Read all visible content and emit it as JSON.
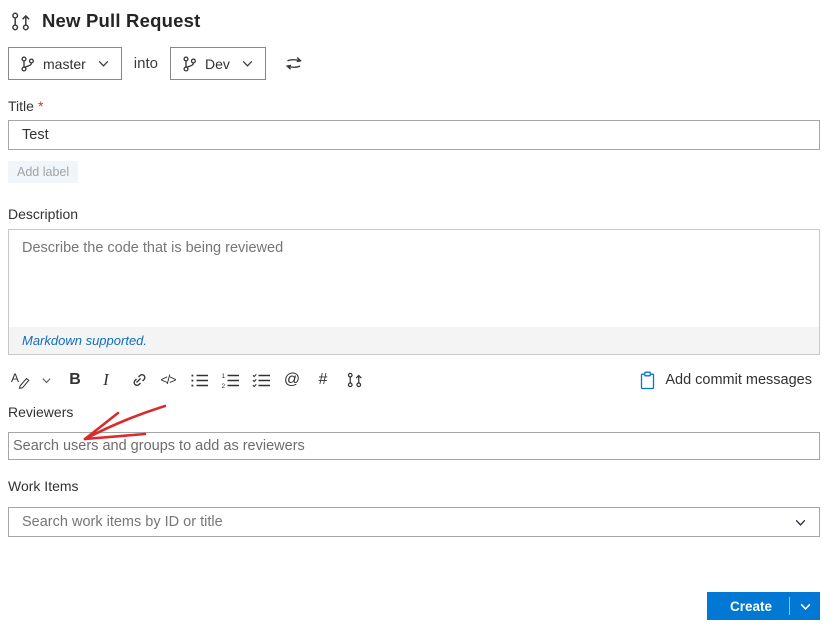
{
  "page": {
    "title": "New Pull Request"
  },
  "branch_selector": {
    "source_branch": "master",
    "into_label": "into",
    "target_branch": "Dev"
  },
  "title_field": {
    "label": "Title",
    "required_marker": "*",
    "value": "Test"
  },
  "labels_section": {
    "add_label": "Add label"
  },
  "description_field": {
    "label": "Description",
    "placeholder": "Describe the code that is being reviewed",
    "markdown_note": "Markdown supported."
  },
  "toolbar": {
    "bold": "B",
    "italic": "I",
    "code": "</>",
    "mention": "@",
    "work_item_ref": "#",
    "add_commit_messages": "Add commit messages"
  },
  "reviewers_field": {
    "label": "Reviewers",
    "placeholder": "Search users and groups to add as reviewers"
  },
  "work_items_field": {
    "label": "Work Items",
    "placeholder": "Search work items by ID or title"
  },
  "actions": {
    "create": "Create"
  },
  "colors": {
    "primary_blue": "#0078d4",
    "link_blue": "#106ebe",
    "required_red": "#d13438",
    "annotation_red": "#d92b2b",
    "input_border": "#a6a6a6",
    "markdown_bar_bg": "#f4f4f4"
  },
  "icons": {
    "pull_request": "pull-request-icon",
    "branch": "git-branch-icon",
    "swap": "swap-arrows-icon",
    "format_color": "text-format-pen-icon",
    "link": "link-icon",
    "bullet_list": "bullet-list-icon",
    "numbered_list": "numbered-list-icon",
    "check_list": "check-list-icon",
    "clipboard": "clipboard-icon",
    "chevron_down": "chevron-down-icon"
  }
}
